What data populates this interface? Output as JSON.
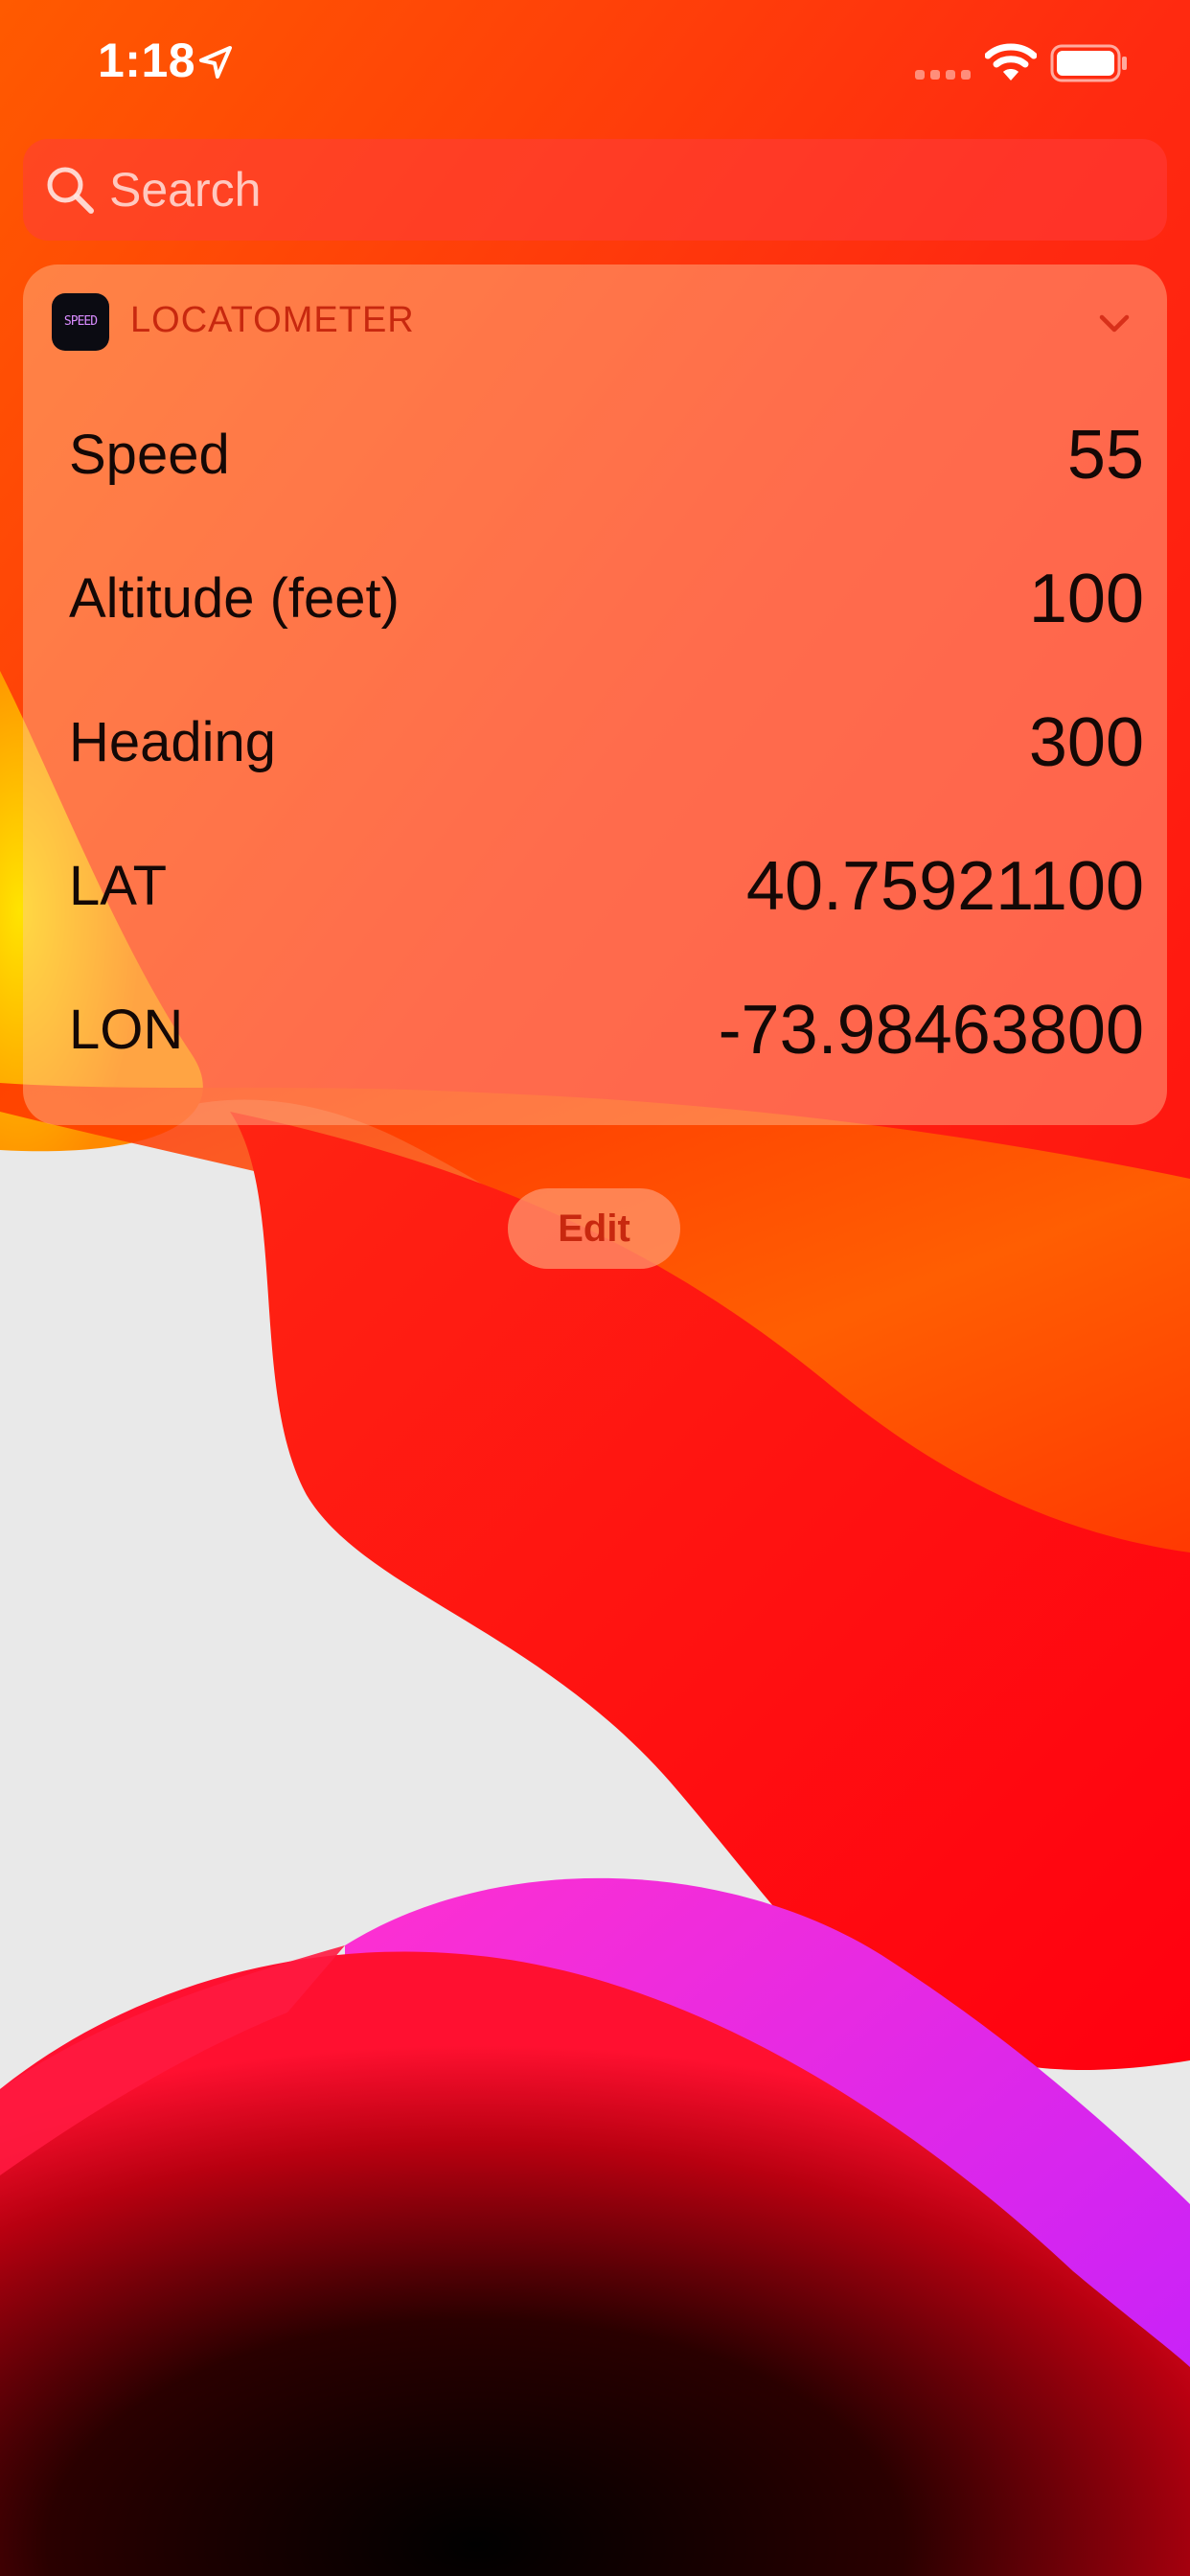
{
  "status_bar": {
    "time": "1:18",
    "location_icon": "location-arrow-icon",
    "signal_icon": "cellular-signal-icon",
    "wifi_icon": "wifi-icon",
    "battery_icon": "battery-icon"
  },
  "search": {
    "placeholder": "Search",
    "value": "",
    "icon": "search-icon"
  },
  "widget": {
    "app_icon_text": "SPEED",
    "app_name": "LOCATOMETER",
    "collapse_icon": "chevron-down-icon",
    "rows": [
      {
        "label": "Speed",
        "value": "55"
      },
      {
        "label": "Altitude (feet)",
        "value": "100"
      },
      {
        "label": "Heading",
        "value": "300"
      },
      {
        "label": "LAT",
        "value": "40.75921100"
      },
      {
        "label": "LON",
        "value": "-73.98463800"
      }
    ]
  },
  "edit_button": {
    "label": "Edit"
  },
  "colors": {
    "accent": "#c8280f",
    "wallpaper_red": "#ff1a14",
    "wallpaper_orange": "#ff6a00",
    "wallpaper_yellow": "#ffd200",
    "wallpaper_magenta": "#e63cf0",
    "wallpaper_background": "#e9e9e9"
  }
}
